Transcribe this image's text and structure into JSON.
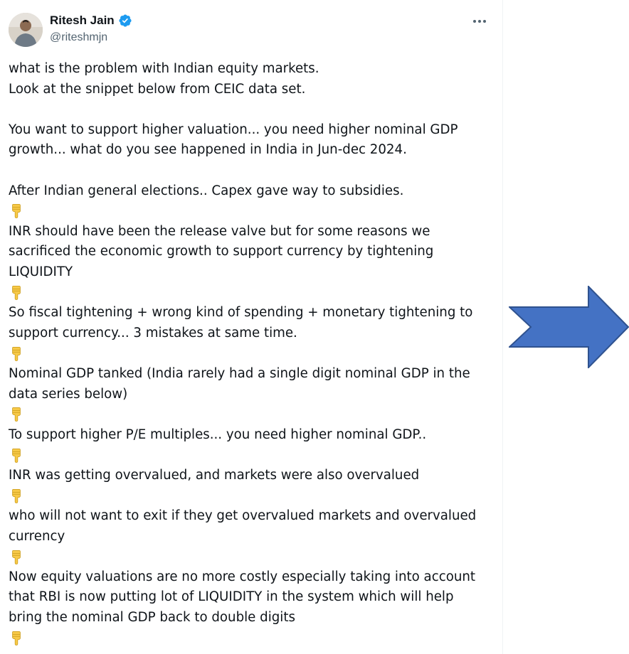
{
  "tweet": {
    "author": {
      "name": "Ritesh Jain",
      "handle": "@riteshmjn",
      "verified": true,
      "avatar_icon": "profile-photo"
    },
    "more_icon": "more-horizontal-icon",
    "emoji_icon": "backhand-index-pointing-down-icon",
    "paragraphs": [
      {
        "lines": [
          "what is the problem with Indian equity markets.",
          "Look at the snippet below from CEIC data set."
        ]
      },
      {
        "blank": true
      },
      {
        "lines": [
          "You want to support higher valuation... you need higher nominal GDP",
          "growth... what do you see happened in India in Jun-dec 2024."
        ]
      },
      {
        "blank": true
      },
      {
        "lines": [
          "After Indian general elections.. Capex gave way to subsidies."
        ]
      },
      {
        "emoji": true
      },
      {
        "lines": [
          "INR should have been the release valve but for some reasons we",
          "sacrificed the economic growth to support currency by tightening",
          "LIQUIDITY"
        ]
      },
      {
        "emoji": true
      },
      {
        "lines": [
          "So fiscal tightening + wrong kind of spending + monetary tightening to",
          "support currency... 3 mistakes at same time."
        ]
      },
      {
        "emoji": true
      },
      {
        "lines": [
          "Nominal GDP tanked (India rarely had a single digit nominal GDP in the",
          "data series below)"
        ]
      },
      {
        "emoji": true
      },
      {
        "lines": [
          "To support higher P/E multiples... you need higher nominal GDP.."
        ]
      },
      {
        "emoji": true
      },
      {
        "lines": [
          "INR was getting overvalued, and markets were also overvalued"
        ]
      },
      {
        "emoji": true
      },
      {
        "lines": [
          "who will not want to exit if they get overvalued markets and overvalued",
          "currency"
        ]
      },
      {
        "emoji": true
      },
      {
        "lines": [
          "Now equity valuations are no more costly especially taking into account",
          "that RBI is now putting lot of LIQUIDITY in the system which will help",
          "bring the nominal GDP back to double digits"
        ]
      },
      {
        "emoji": true
      }
    ]
  },
  "right_pane": {
    "arrow_icon": "right-arrow-icon",
    "arrow_color": "#4472c4",
    "arrow_outline": "#2f528f"
  },
  "colors": {
    "text": "#0f1419",
    "secondary": "#536471",
    "verified": "#1d9bf0",
    "emoji": "#f7c948"
  }
}
